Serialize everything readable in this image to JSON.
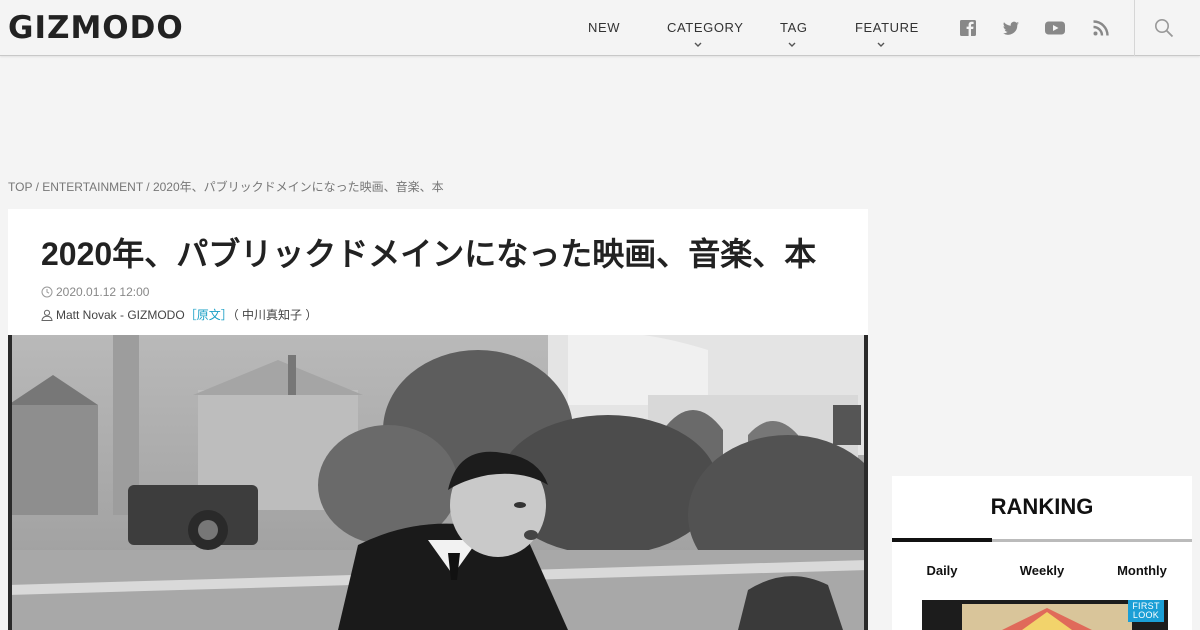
{
  "header": {
    "logo": "GIZMODO",
    "nav": [
      {
        "label": "NEW",
        "dropdown": false
      },
      {
        "label": "CATEGORY",
        "dropdown": true
      },
      {
        "label": "TAG",
        "dropdown": true
      },
      {
        "label": "FEATURE",
        "dropdown": true
      }
    ],
    "social_icons": [
      "facebook-icon",
      "twitter-icon",
      "youtube-icon",
      "rss-icon"
    ],
    "search_icon": "search-icon"
  },
  "breadcrumb": {
    "items": [
      "TOP",
      "ENTERTAINMENT",
      "2020年、パブリックドメインになった映画、音楽、本"
    ],
    "separator": " / "
  },
  "article": {
    "title": "2020年、パブリックドメインになった映画、音楽、本",
    "date": "2020.01.12 12:00",
    "author": "Matt Novak - GIZMODO",
    "original_link": "［原文］",
    "translator": "（ 中川真知子 ）"
  },
  "ranking": {
    "title": "RANKING",
    "tabs": [
      "Daily",
      "Weekly",
      "Monthly"
    ],
    "active_tab": "Daily",
    "thumbnail_badge": "FIRST LOOK"
  },
  "colors": {
    "background": "#f4f4f4",
    "link": "#1aa0c6",
    "badge": "#1b9fd6"
  }
}
